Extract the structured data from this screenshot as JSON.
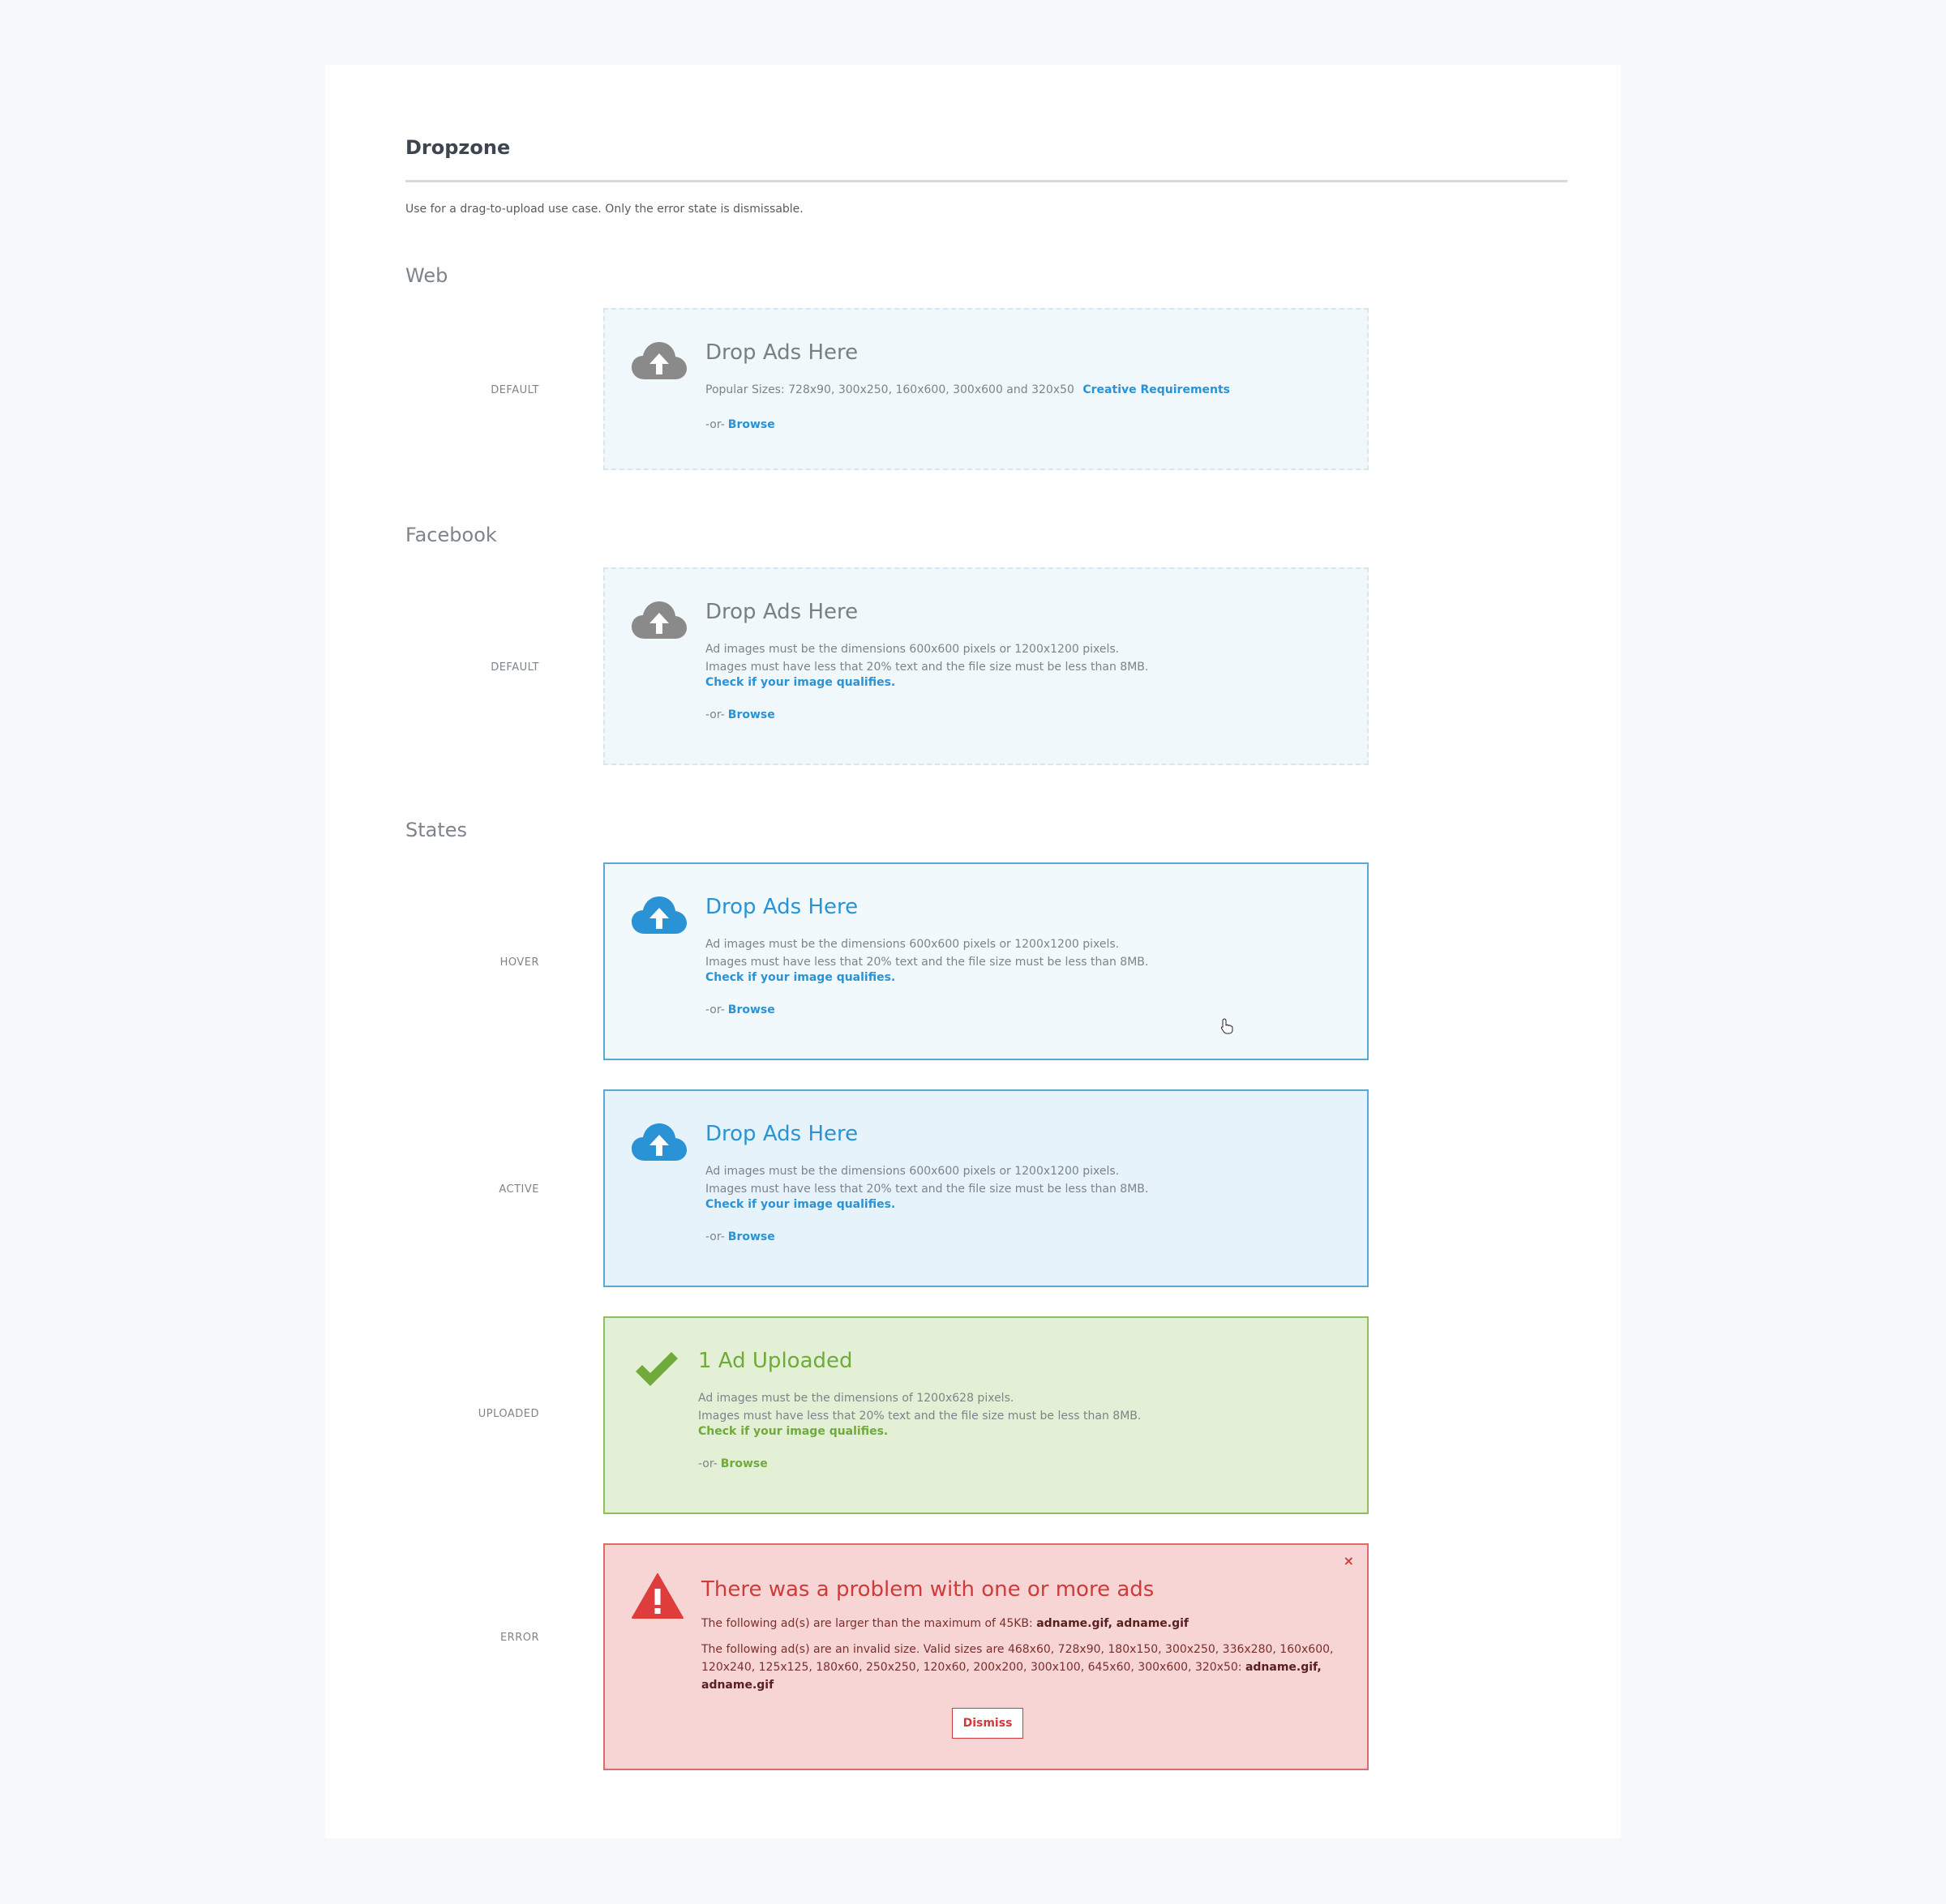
{
  "page": {
    "title": "Dropzone",
    "description": "Use for a drag-to-upload use case. Only the error state is dismissable."
  },
  "sections": {
    "web": "Web",
    "facebook": "Facebook",
    "states": "States"
  },
  "labels": {
    "default": "DEFAULT",
    "hover": "HOVER",
    "active": "ACTIVE",
    "uploaded": "UPLOADED",
    "error": "ERROR"
  },
  "web_default": {
    "title": "Drop Ads Here",
    "sizes_text": "Popular Sizes: 728x90, 300x250, 160x600, 300x600 and 320x50",
    "requirements_link": "Creative Requirements",
    "or": "-or-",
    "browse": "Browse"
  },
  "facebook_default": {
    "title": "Drop Ads Here",
    "line1": "Ad images must be the dimensions 600x600 pixels or 1200x1200 pixels.",
    "line2": "Images must have less that 20% text and the file size must be less than 8MB.",
    "link": "Check if your image qualifies.",
    "or": "-or-",
    "browse": "Browse"
  },
  "hover_state": {
    "title": "Drop Ads Here",
    "line1": "Ad images must be the dimensions 600x600 pixels or 1200x1200 pixels.",
    "line2": "Images must have less that 20% text and the file size must be less than 8MB.",
    "link": "Check if your image qualifies.",
    "or": "-or-",
    "browse": "Browse"
  },
  "active_state": {
    "title": "Drop Ads Here",
    "line1": "Ad images must be the dimensions 600x600 pixels or 1200x1200 pixels.",
    "line2": "Images must have less that 20% text and the file size must be less than 8MB.",
    "link": "Check if your image qualifies.",
    "or": "-or-",
    "browse": "Browse"
  },
  "uploaded_state": {
    "title": "1 Ad Uploaded",
    "line1": "Ad images must be the dimensions of 1200x628 pixels.",
    "line2": "Images must have less that 20% text and the file size must be less than 8MB.",
    "link": "Check if your image qualifies.",
    "or": "-or-",
    "browse": "Browse"
  },
  "error_state": {
    "title": "There was a problem with one or more ads",
    "size_error": "The following ad(s) are larger than the maximum of 45KB:",
    "size_error_files": "adname.gif, adname.gif",
    "invalid_error_line1": "The following ad(s) are an invalid size. Valid sizes are 468x60, 728x90, 180x150, 300x250, 336x280, 160x600,",
    "invalid_error_line2": "120x240, 125x125, 180x60, 250x250, 120x60, 200x200, 300x100, 645x60, 300x600, 320x50:",
    "invalid_error_files": "adname.gif, adname.gif",
    "dismiss": "Dismiss",
    "close": "×"
  },
  "icons": {
    "upload": "cloud-upload-icon",
    "check": "checkmark-icon",
    "warning": "warning-triangle-icon",
    "close": "close-icon",
    "cursor": "hand-cursor-icon"
  },
  "colors": {
    "blue": "#2a93d5",
    "gray_icon": "#8a8a8a",
    "green": "#6faa3a",
    "red": "#d03a3a",
    "default_bg": "#f0f8fb",
    "active_bg": "#e6f3fb",
    "uploaded_bg": "#e3f0d6",
    "error_bg": "#f8d5d5"
  }
}
